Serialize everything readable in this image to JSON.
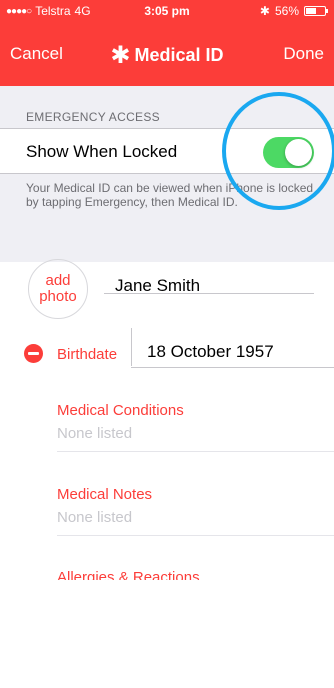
{
  "status_bar": {
    "carrier": "Telstra",
    "network": "4G",
    "time": "3:05 pm",
    "bluetooth_icon": "bluetooth-icon",
    "battery_text": "56%",
    "battery_level": 0.56
  },
  "nav": {
    "cancel_label": "Cancel",
    "title_icon": "asterisk-icon",
    "title": "Medical ID",
    "done_label": "Done"
  },
  "emergency": {
    "header": "EMERGENCY ACCESS",
    "toggle_label": "Show When Locked",
    "toggle_on": true,
    "footer": "Your Medical ID can be viewed when iPhone is locked by tapping Emergency, then Medical ID."
  },
  "profile": {
    "photo_label": "add photo",
    "name": "Jane Smith"
  },
  "birthdate": {
    "label": "Birthdate",
    "value": "18 October 1957"
  },
  "fields": [
    {
      "label": "Medical Conditions",
      "value": "None listed"
    },
    {
      "label": "Medical Notes",
      "value": "None listed"
    }
  ],
  "partial_field": {
    "label": "Allergies & Reactions"
  },
  "colors": {
    "accent": "#fc3d39",
    "switch_on": "#4cd964",
    "highlight_ring": "#1aa8f0",
    "grouped_bg": "#efeff4"
  }
}
